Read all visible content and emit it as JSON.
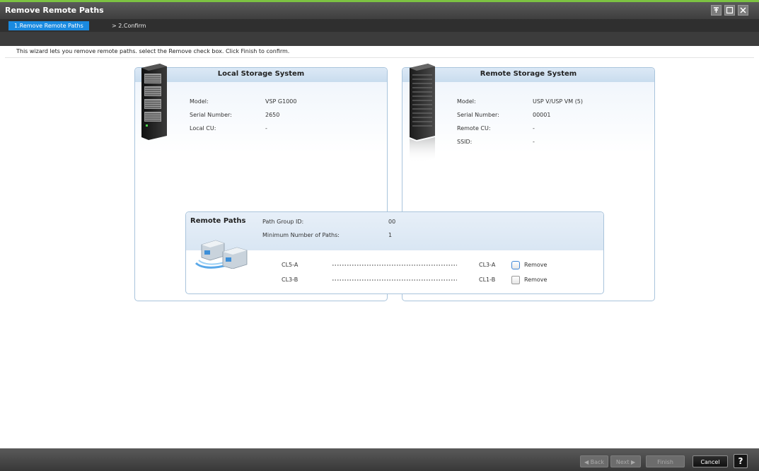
{
  "window": {
    "title": "Remove Remote Paths",
    "controls": [
      "pin-icon",
      "maximize-icon",
      "close-icon"
    ]
  },
  "wizard": {
    "steps": [
      {
        "label": "1.Remove Remote Paths",
        "active": true
      },
      {
        "label": "> 2.Confirm",
        "active": false
      }
    ],
    "instruction": "This wizard lets you remove remote paths. select the Remove check box. Click Finish to confirm."
  },
  "local": {
    "title": "Local Storage System",
    "icon": "storage-rack-icon",
    "props": [
      {
        "label": "Model:",
        "value": "VSP G1000"
      },
      {
        "label": "Serial Number:",
        "value": "2650"
      },
      {
        "label": "Local CU:",
        "value": "-"
      }
    ]
  },
  "remote": {
    "title": "Remote Storage System",
    "icon": "storage-server-icon",
    "props": [
      {
        "label": "Model:",
        "value": "USP V/USP VM (5)"
      },
      {
        "label": "Serial Number:",
        "value": "00001"
      },
      {
        "label": "Remote CU:",
        "value": "-"
      },
      {
        "label": "SSID:",
        "value": "-"
      }
    ]
  },
  "remote_paths": {
    "title": "Remote Paths",
    "icon": "connected-servers-icon",
    "path_group_label": "Path Group ID:",
    "path_group_value": "00",
    "min_paths_label": "Minimum Number of Paths:",
    "min_paths_value": "1",
    "paths": [
      {
        "local_port": "CL5-A",
        "remote_port": "CL3-A",
        "remove_label": "Remove",
        "checked": false
      },
      {
        "local_port": "CL3-B",
        "remote_port": "CL1-B",
        "remove_label": "Remove",
        "checked": false
      }
    ]
  },
  "footer": {
    "back": "◀ Back",
    "next": "Next ▶",
    "finish": "Finish",
    "cancel": "Cancel",
    "help": "?"
  },
  "colors": {
    "accent_green": "#7cc242",
    "active_step": "#1a8ae0",
    "panel_border": "#a9c4dc"
  }
}
